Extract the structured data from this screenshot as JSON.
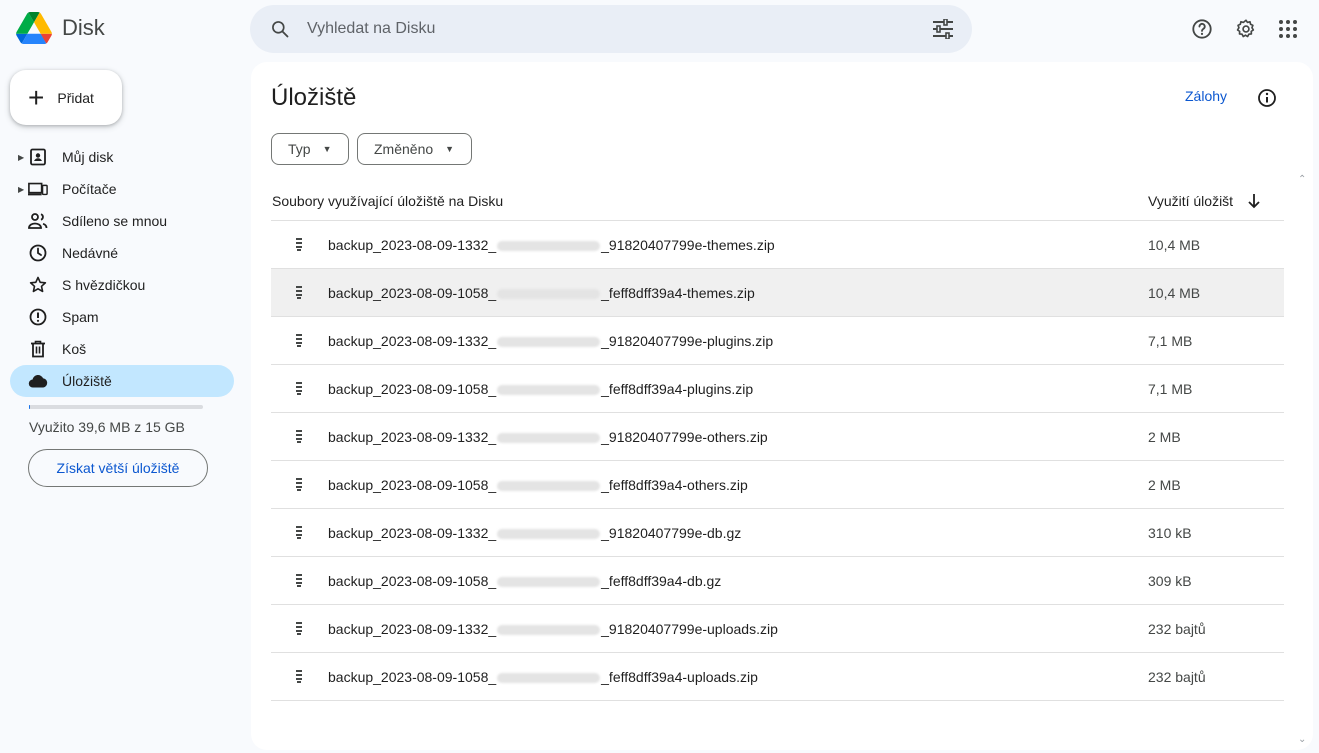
{
  "app": {
    "name": "Disk"
  },
  "search": {
    "placeholder": "Vyhledat na Disku"
  },
  "new_button": {
    "label": "Přidat"
  },
  "sidebar": {
    "items": [
      {
        "label": "Můj disk",
        "icon": "my-drive-icon",
        "expandable": true
      },
      {
        "label": "Počítače",
        "icon": "computers-icon",
        "expandable": true
      },
      {
        "label": "Sdíleno se mnou",
        "icon": "shared-icon"
      },
      {
        "label": "Nedávné",
        "icon": "clock-icon"
      },
      {
        "label": "S hvězdičkou",
        "icon": "star-icon"
      },
      {
        "label": "Spam",
        "icon": "spam-icon"
      },
      {
        "label": "Koš",
        "icon": "trash-icon"
      },
      {
        "label": "Úložiště",
        "icon": "cloud-icon",
        "active": true
      }
    ],
    "storage_text": "Využito 39,6 MB z 15 GB",
    "storage_fraction": 0.0026,
    "get_more_label": "Získat větší úložiště"
  },
  "main": {
    "title": "Úložiště",
    "backups_label": "Zálohy",
    "filters": {
      "type_label": "Typ",
      "modified_label": "Změněno"
    },
    "columns": {
      "name": "Soubory využívající úložiště na Disku",
      "size": "Využití úložišt"
    },
    "files": [
      {
        "name_prefix": "backup_2023-08-09-1332_",
        "name_suffix": "_91820407799e-themes.zip",
        "size": "10,4 MB"
      },
      {
        "name_prefix": "backup_2023-08-09-1058_",
        "name_suffix": "_feff8dff39a4-themes.zip",
        "size": "10,4 MB",
        "highlighted": true
      },
      {
        "name_prefix": "backup_2023-08-09-1332_",
        "name_suffix": "_91820407799e-plugins.zip",
        "size": "7,1 MB"
      },
      {
        "name_prefix": "backup_2023-08-09-1058_",
        "name_suffix": "_feff8dff39a4-plugins.zip",
        "size": "7,1 MB"
      },
      {
        "name_prefix": "backup_2023-08-09-1332_",
        "name_suffix": "_91820407799e-others.zip",
        "size": "2 MB"
      },
      {
        "name_prefix": "backup_2023-08-09-1058_",
        "name_suffix": "_feff8dff39a4-others.zip",
        "size": "2 MB"
      },
      {
        "name_prefix": "backup_2023-08-09-1332_",
        "name_suffix": "_91820407799e-db.gz",
        "size": "310 kB"
      },
      {
        "name_prefix": "backup_2023-08-09-1058_",
        "name_suffix": "_feff8dff39a4-db.gz",
        "size": "309 kB"
      },
      {
        "name_prefix": "backup_2023-08-09-1332_",
        "name_suffix": "_91820407799e-uploads.zip",
        "size": "232 bajtů"
      },
      {
        "name_prefix": "backup_2023-08-09-1058_",
        "name_suffix": "_feff8dff39a4-uploads.zip",
        "size": "232 bajtů"
      }
    ]
  },
  "colors": {
    "accent": "#0b57d0",
    "active_nav": "#c2e7ff",
    "search_bg": "#e9eef6",
    "page_bg": "#f8fafd"
  }
}
